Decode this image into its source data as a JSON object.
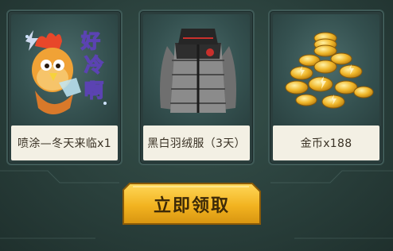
{
  "rewards": [
    {
      "label": "喷涂—冬天来临x1",
      "icon": "rooster-spray-icon"
    },
    {
      "label": "黑白羽绒服（3天）",
      "icon": "down-jacket-icon"
    },
    {
      "label": "金币x188",
      "icon": "gold-coins-icon"
    }
  ],
  "claim_button": {
    "label": "立即领取"
  },
  "spray_art_text": "好冷啊",
  "colors": {
    "background": "#2f4642",
    "card_border": "#3f5a57",
    "label_bg": "#f3f0e4",
    "button_gold": "#f2b320",
    "text_dark": "#3a3225"
  }
}
